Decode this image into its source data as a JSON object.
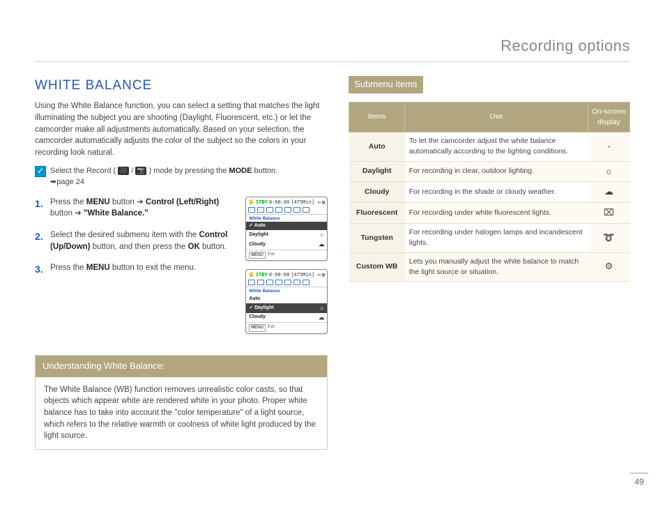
{
  "header": {
    "title": "Recording options"
  },
  "page_number": "49",
  "left": {
    "heading": "WHITE BALANCE",
    "intro": "Using the White Balance function, you can select a setting that matches the light illuminating the subject you are shooting (Daylight, Fluorescent, etc.) or let the camcorder make all adjustments automatically. Based on your selection, the camcorder automatically adjusts the color of the subject so the colors in your recording look natural.",
    "mode_select_pre": "Select the Record (",
    "mode_select_mid": " / ",
    "mode_select_post": ") mode by pressing the ",
    "mode_select_bold": "MODE",
    "mode_select_end": " button.",
    "mode_page_ref": "➥page 24",
    "steps": [
      {
        "n": "1.",
        "pre": "Press the ",
        "b1": "MENU",
        "mid1": " button ➔ ",
        "b2": "Control (Left/Right)",
        "mid2": " button ➔ ",
        "b3": "\"White Balance.\""
      },
      {
        "n": "2.",
        "pre": "Select the desired submenu item with the ",
        "b1": "Control (Up/Down)",
        "mid1": " button, and then press the ",
        "b2": "OK",
        "mid2": " button.",
        "b3": ""
      },
      {
        "n": "3.",
        "pre": "Press the ",
        "b1": "MENU",
        "mid1": " button to exit the menu.",
        "b2": "",
        "mid2": "",
        "b3": ""
      }
    ],
    "lcd": {
      "stby": "STBY",
      "time": "0:00:00",
      "remain": "[475Min]",
      "title": "White Balance",
      "items": [
        "Auto",
        "Daylight",
        "Cloudy"
      ],
      "exit_btn": "MENU",
      "exit_label": "Exit",
      "sel_icon": "✓"
    },
    "understanding": {
      "title": "Understanding White Balance:",
      "body": "The White Balance (WB) function removes unrealistic color casts, so that objects which appear white are rendered white in your photo. Proper white balance has to take into account the \"color temperature\" of a light source, which refers to the relative warmth or coolness of white light produced by the light source."
    }
  },
  "right": {
    "submenu_heading": "Submenu items",
    "th": [
      "Items",
      "Use",
      "On-screen display"
    ],
    "rows": [
      {
        "item": "Auto",
        "use": "To let the camcorder adjust the white balance automatically according to the lighting conditions.",
        "disp": "-"
      },
      {
        "item": "Daylight",
        "use": "For recording in clear, outdoor lighting.",
        "disp": "☼"
      },
      {
        "item": "Cloudy",
        "use": "For recording in the shade or cloudy weather.",
        "disp": "☁"
      },
      {
        "item": "Fluorescent",
        "use": "For recording under white fluorescent lights.",
        "disp": "⌧"
      },
      {
        "item": "Tungsten",
        "use": "For recording under halogen lamps and incandescent lights.",
        "disp": "➰"
      },
      {
        "item": "Custom WB",
        "use": "Lets you manually adjust the white balance to match the light source or situation.",
        "disp": "⚙"
      }
    ]
  }
}
